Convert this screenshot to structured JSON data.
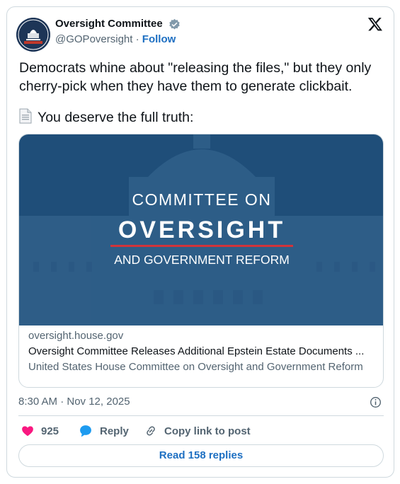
{
  "account": {
    "name": "Oversight Committee",
    "handle": "@GOPoversight",
    "separator": "·",
    "follow_label": "Follow"
  },
  "tweet": {
    "text": "Democrats whine about \"releasing the files,\" but they only cherry-pick when they have them to generate clickbait.",
    "text2": "You deserve the full truth:",
    "emoji": "page-facing-up"
  },
  "link_card": {
    "banner": {
      "line1": "COMMITTEE ON",
      "line2": "OVERSIGHT",
      "line3": "AND GOVERNMENT REFORM"
    },
    "domain": "oversight.house.gov",
    "title": "Oversight Committee Releases Additional Epstein Estate Documents ...",
    "description": "United States House Committee on Oversight and Government Reform"
  },
  "timestamp": "8:30 AM · Nov 12, 2025",
  "actions": {
    "likes": "925",
    "reply_label": "Reply",
    "copy_label": "Copy link to post"
  },
  "read_replies_label": "Read 158 replies",
  "colors": {
    "accent": "#1d6fc2",
    "like": "#f91880",
    "banner_bg": "#1f4e79",
    "banner_rule": "#d0343a"
  }
}
